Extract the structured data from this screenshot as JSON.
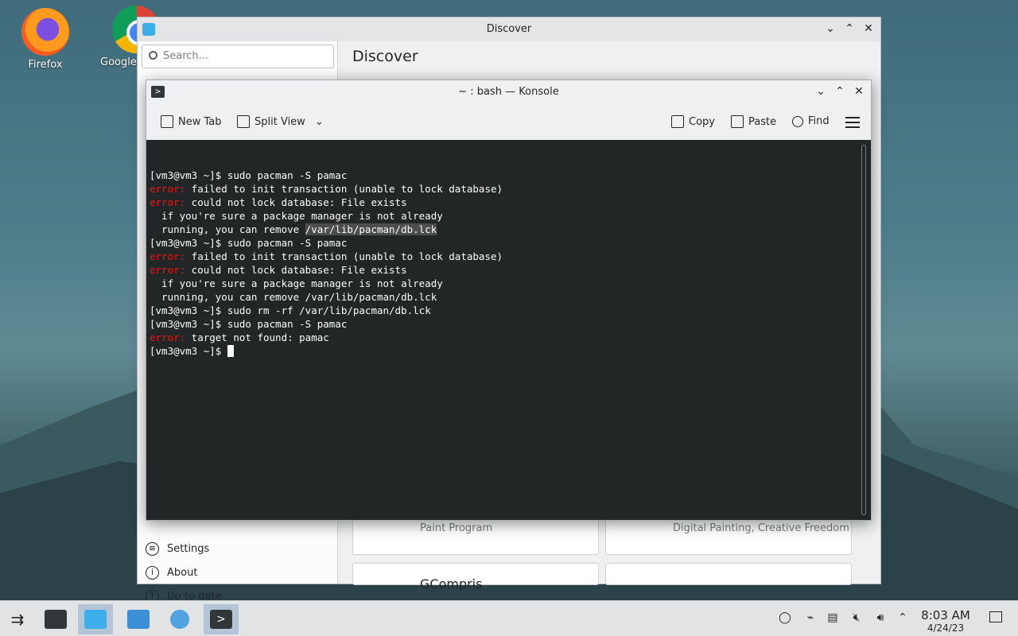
{
  "desktop": {
    "icons": [
      {
        "label": "Firefox",
        "icon": "firefox-icon"
      },
      {
        "label": "Google",
        "icon": "chrome-icon"
      }
    ]
  },
  "discover": {
    "title": "Discover",
    "search_placeholder": "Search...",
    "heading": "Discover",
    "sidebar": [
      {
        "label": "Settings",
        "icon": "settings-icon"
      },
      {
        "label": "About",
        "icon": "info-icon"
      },
      {
        "label": "Up to date",
        "icon": "update-icon"
      }
    ],
    "cards": [
      {
        "desc": "Paint Program"
      },
      {
        "desc": "Digital Painting, Creative Freedom"
      },
      {
        "name": "GCompris"
      }
    ]
  },
  "konsole": {
    "title": "~ : bash — Konsole",
    "toolbar": {
      "new_tab": "New Tab",
      "split_view": "Split View",
      "copy": "Copy",
      "paste": "Paste",
      "find": "Find"
    },
    "lines": [
      {
        "prompt": "[vm3@vm3 ~]$ ",
        "text": "sudo pacman -S pamac"
      },
      {
        "err": "error:",
        "text": " failed to init transaction (unable to lock database)"
      },
      {
        "err": "error:",
        "text": " could not lock database: File exists"
      },
      {
        "text": "  if you're sure a package manager is not already"
      },
      {
        "text": "  running, you can remove ",
        "sel": "/var/lib/pacman/db.lck"
      },
      {
        "prompt": "[vm3@vm3 ~]$ ",
        "text": "sudo pacman -S pamac"
      },
      {
        "err": "error:",
        "text": " failed to init transaction (unable to lock database)"
      },
      {
        "err": "error:",
        "text": " could not lock database: File exists"
      },
      {
        "text": "  if you're sure a package manager is not already"
      },
      {
        "text": "  running, you can remove /var/lib/pacman/db.lck"
      },
      {
        "prompt": "[vm3@vm3 ~]$ ",
        "text": "sudo rm -rf /var/lib/pacman/db.lck"
      },
      {
        "prompt": "[vm3@vm3 ~]$ ",
        "text": "sudo pacman -S pamac"
      },
      {
        "err": "error:",
        "text": " target not found: pamac"
      },
      {
        "prompt": "[vm3@vm3 ~]$ ",
        "text": "",
        "cursor": true
      }
    ]
  },
  "taskbar": {
    "time": "8:03 AM",
    "date": "4/24/23"
  }
}
